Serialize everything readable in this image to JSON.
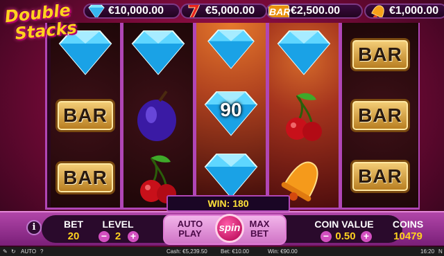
{
  "logo": {
    "line1": "Double",
    "line2": "Stacks"
  },
  "jackpots": [
    {
      "icon": "diamond-icon",
      "value": "€10,000.00"
    },
    {
      "icon": "seven-icon",
      "value": "€5,000.00"
    },
    {
      "icon": "bar-icon",
      "icon_text": "BAR",
      "value": "€2,500.00"
    },
    {
      "icon": "bell-icon",
      "value": "€1,000.00"
    }
  ],
  "reels": {
    "symbol_bar_text": "BAR",
    "win_badge": "90"
  },
  "win": {
    "label": "WIN: 180"
  },
  "controls": {
    "info": "i",
    "bet_label": "BET",
    "bet_value": "20",
    "level_label": "LEVEL",
    "level_value": "2",
    "minus": "−",
    "plus": "+",
    "autoplay_line1": "AUTO",
    "autoplay_line2": "PLAY",
    "spin": "spin",
    "maxbet_line1": "MAX",
    "maxbet_line2": "BET",
    "coin_value_label": "COIN VALUE",
    "coin_value": "0.50",
    "coins_label": "COINS",
    "coins_value": "10479"
  },
  "footer": {
    "auto": "AUTO",
    "help": "?",
    "cash": "Cash: €5,239.50",
    "bet": "Bet: €10.00",
    "win": "Win: €90.00",
    "time": "16:20",
    "brand": "N"
  },
  "colors": {
    "accent": "#b046b6",
    "gold": "#ffd21f",
    "bg": "#7b0a3a"
  }
}
